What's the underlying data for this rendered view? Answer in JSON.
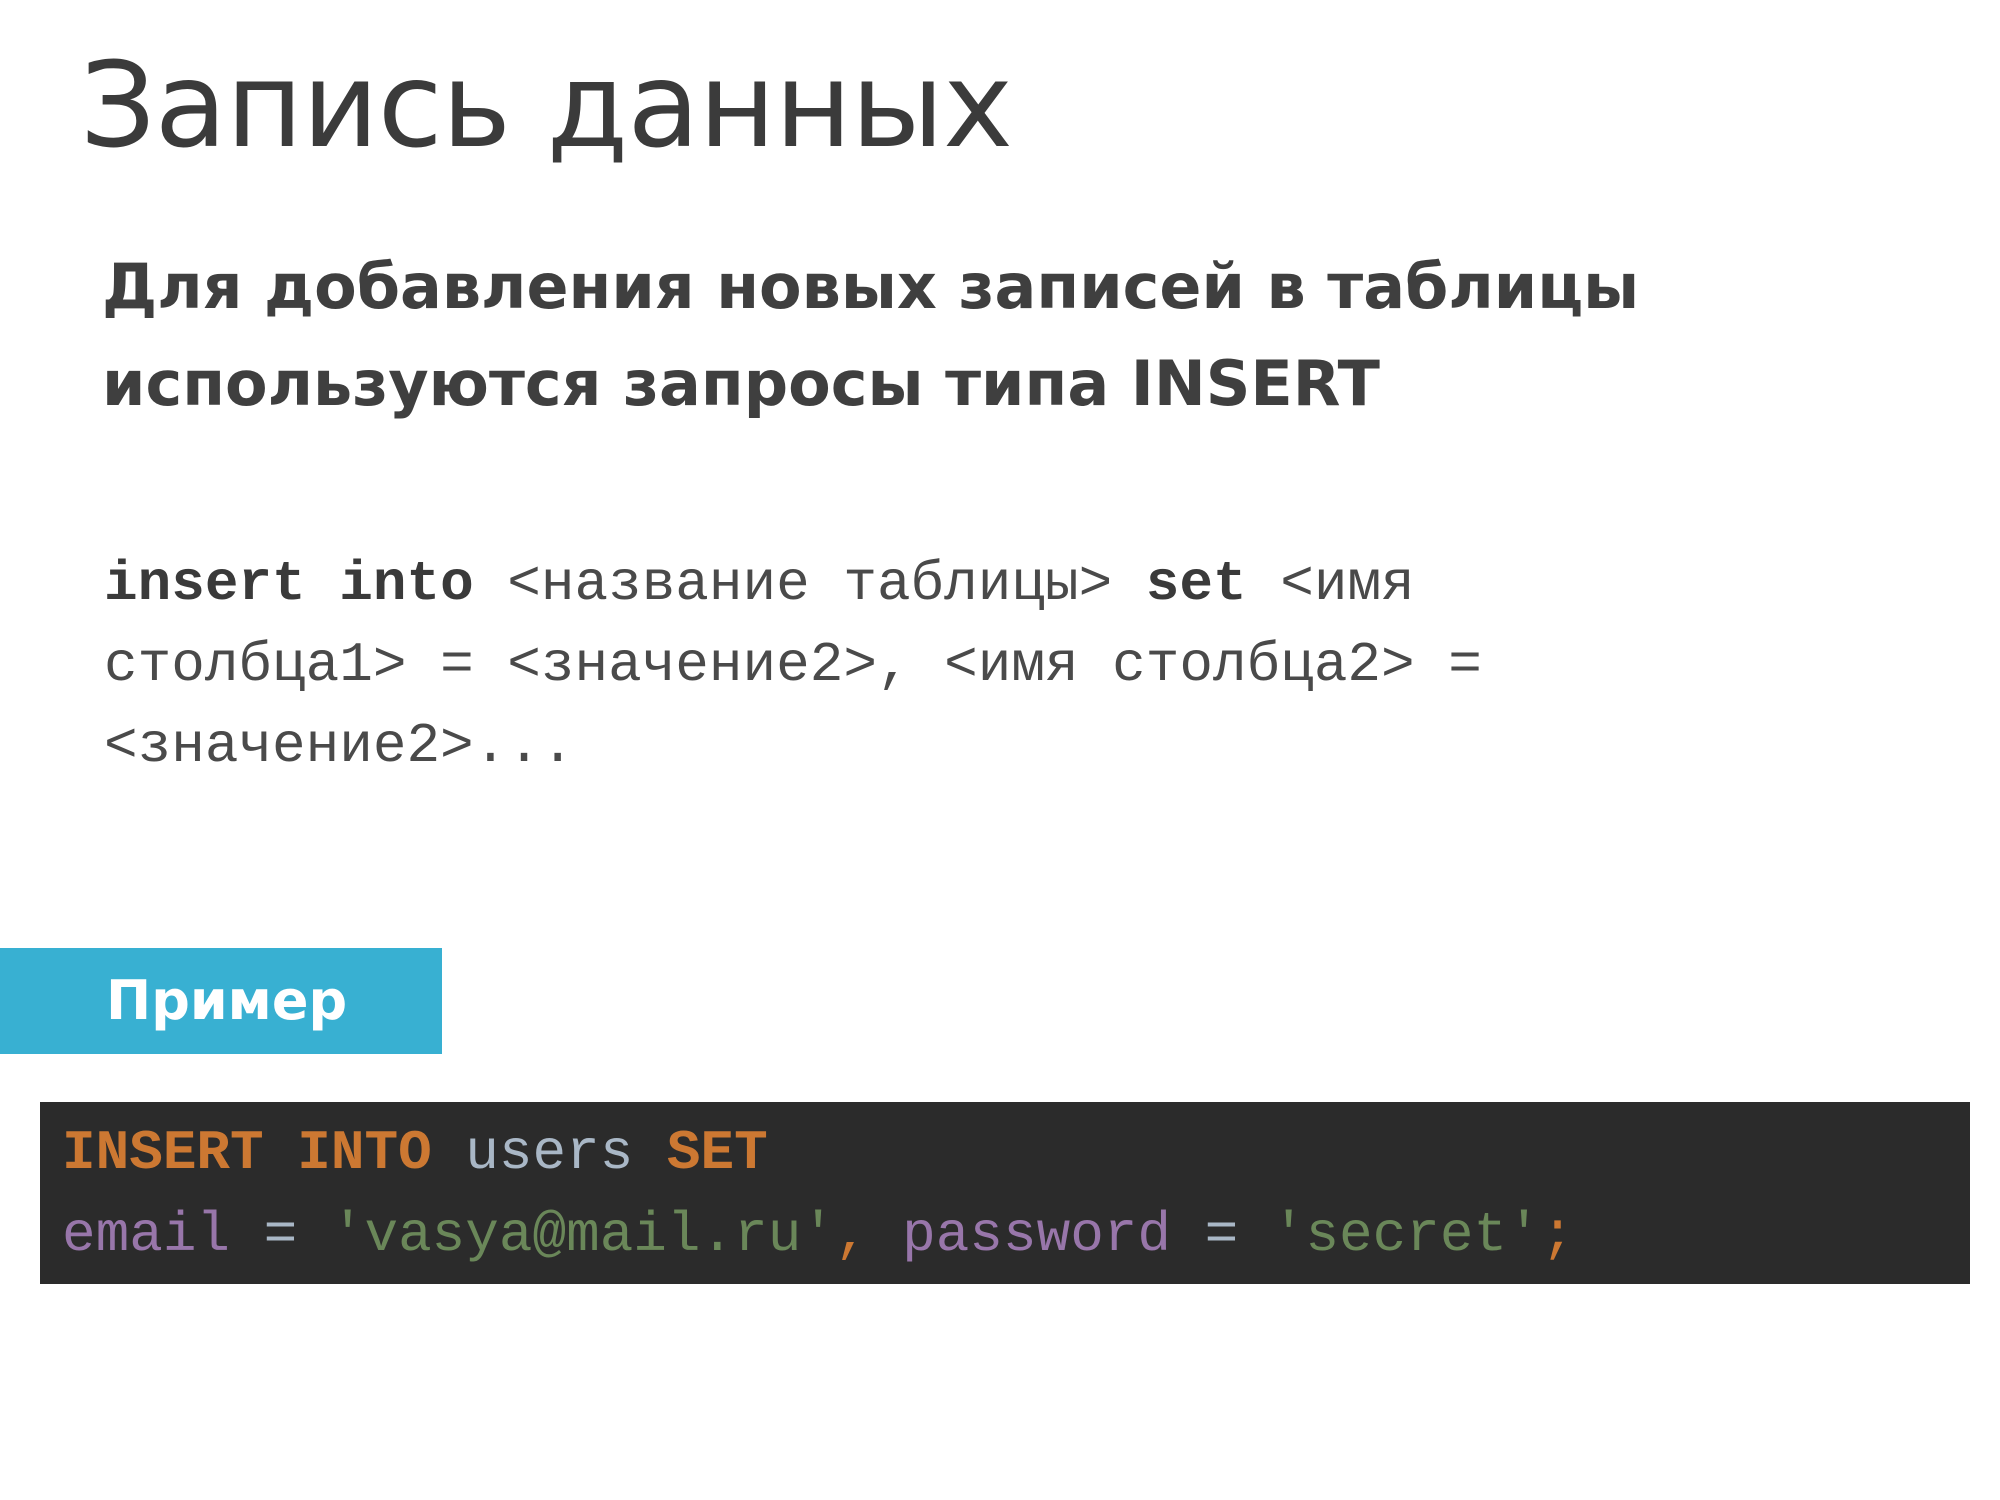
{
  "slide": {
    "title": "Запись данных",
    "subtitle_lines": [
      "Для добавления новых записей в таблицы",
      "используются запросы типа INSERT"
    ]
  },
  "syntax": {
    "kw_insert": "insert",
    "kw_into": "into",
    "table_placeholder": "<название таблицы>",
    "kw_set": "set",
    "col1_part_a": "<имя",
    "col1_part_b": "столбца1>",
    "eq": "=",
    "value1": "<значение2>,",
    "col2": "<имя столбца2>",
    "value2": "<значение2>..."
  },
  "example": {
    "label": "Пример",
    "code": {
      "kw_insert": "INSERT",
      "kw_into": "INTO",
      "table": "users",
      "kw_set": "SET",
      "field1": "email",
      "eq": "=",
      "value1": "'vasya@mail.ru'",
      "comma": ",",
      "field2": "password",
      "value2": "'secret'",
      "semicolon": ";"
    },
    "colors": {
      "background": "#2b2b2b",
      "keyword": "#cc7832",
      "identifier": "#a9b7c6",
      "field": "#9876aa",
      "string": "#6a8759",
      "tab": "#38b0d2"
    }
  }
}
